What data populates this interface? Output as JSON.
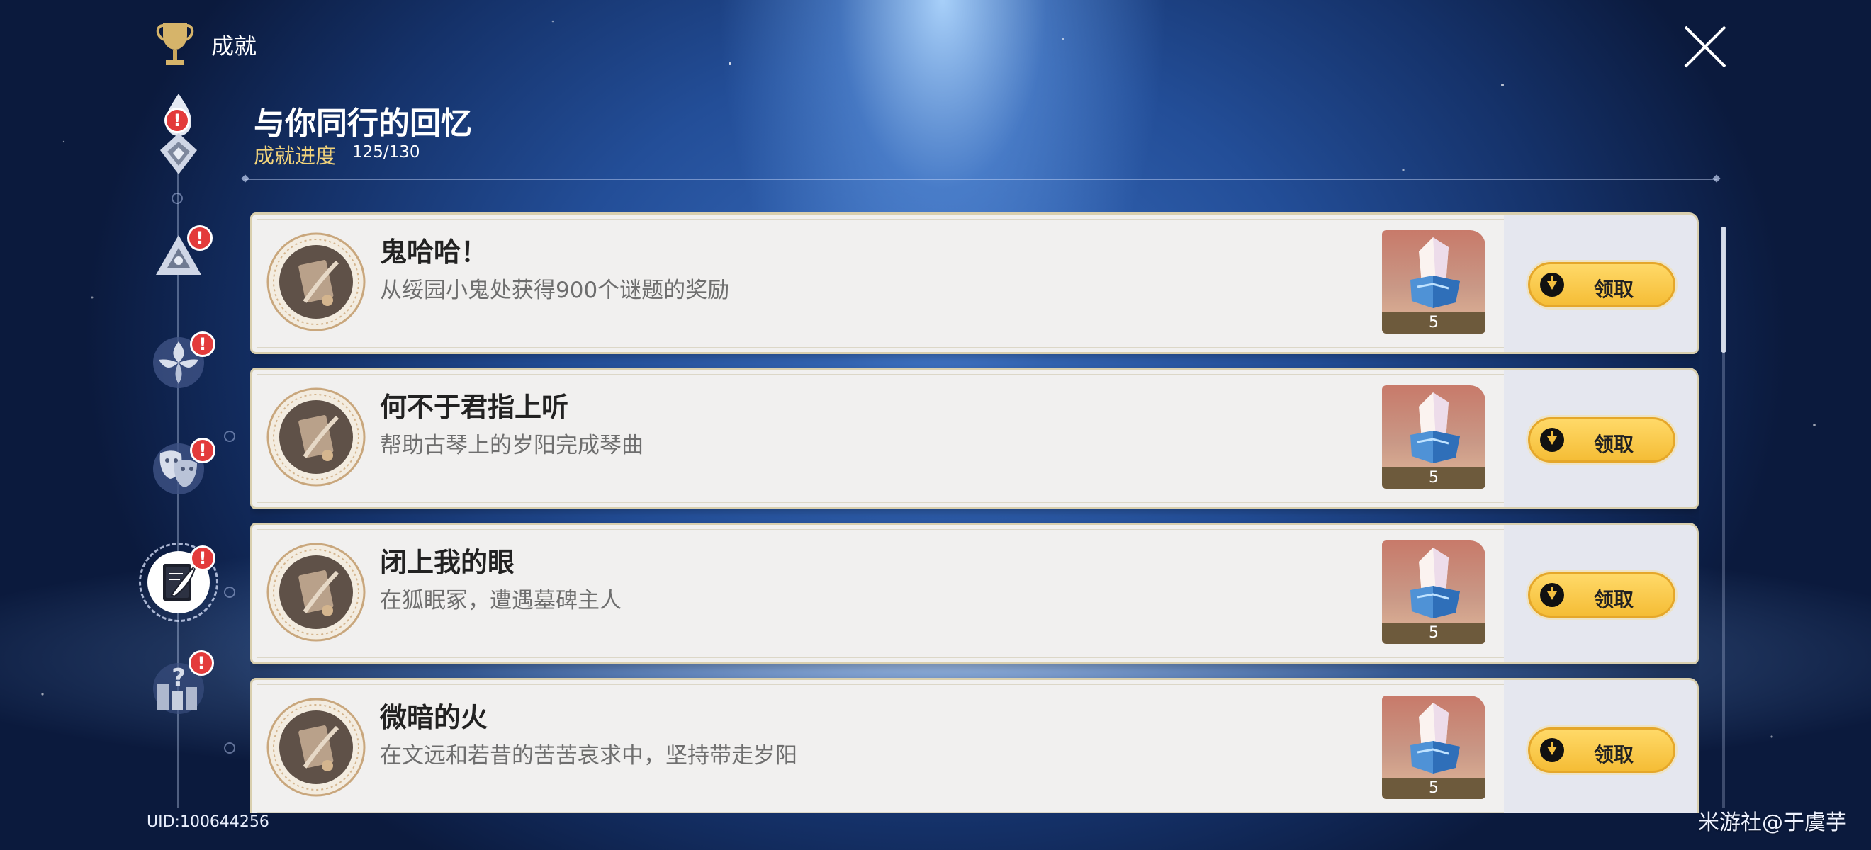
{
  "header": {
    "title": "成就",
    "trophy_icon": "trophy-icon",
    "close_icon": "close-icon"
  },
  "categories": [
    {
      "icon": "teardrop-emblem-icon",
      "active": false,
      "badge": "!"
    },
    {
      "icon": "triangle-emblem-icon",
      "active": false,
      "badge": "!"
    },
    {
      "icon": "flower-emblem-icon",
      "active": false,
      "badge": "!"
    },
    {
      "icon": "masks-icon",
      "active": false,
      "badge": "!"
    },
    {
      "icon": "notebook-quill-icon",
      "active": true,
      "badge": "!"
    },
    {
      "icon": "question-blocks-icon",
      "active": false,
      "badge": "!"
    }
  ],
  "section": {
    "title": "与你同行的回忆",
    "progress_label": "成就进度",
    "progress_value": "125/130"
  },
  "achievements": [
    {
      "title": "鬼哈哈！",
      "desc": "从绥园小鬼处获得900个谜题的奖励",
      "reward_count": "5",
      "claim_label": "领取"
    },
    {
      "title": "何不于君指上听",
      "desc": "帮助古琴上的岁阳完成琴曲",
      "reward_count": "5",
      "claim_label": "领取"
    },
    {
      "title": "闭上我的眼",
      "desc": "在狐眠冢，遭遇墓碑主人",
      "reward_count": "5",
      "claim_label": "领取"
    },
    {
      "title": "微暗的火",
      "desc": "在文远和若昔的苦苦哀求中，坚持带走岁阳",
      "reward_count": "5",
      "claim_label": "领取"
    }
  ],
  "footer": {
    "uid": "UID:100644256",
    "watermark": "米游社@于虞芋"
  },
  "colors": {
    "accent_gold": "#f2d37a",
    "claim_button": "#f5bd36",
    "badge_red": "#e33b3b"
  }
}
